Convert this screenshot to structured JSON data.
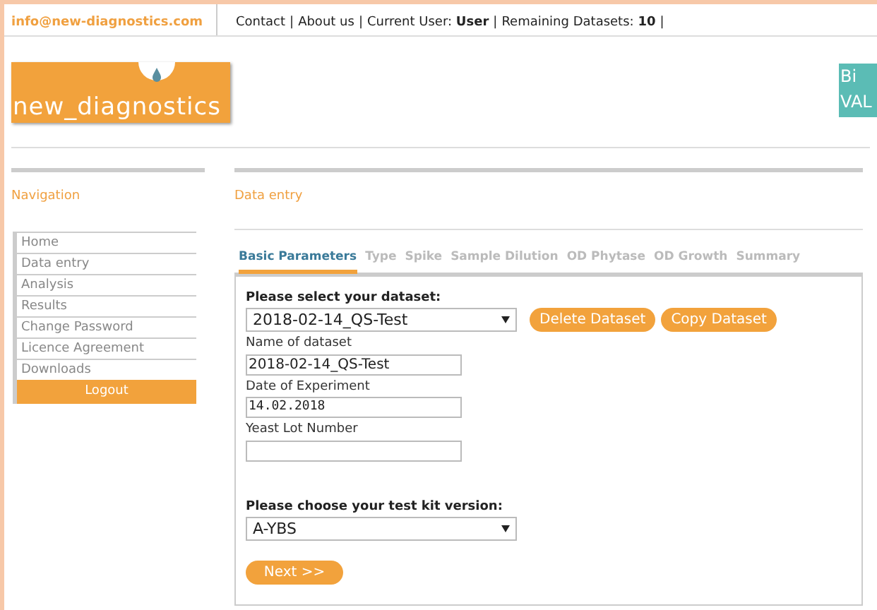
{
  "header": {
    "email": "info@new-diagnostics.com",
    "items": [
      {
        "kind": "link",
        "text": "Contact"
      },
      {
        "kind": "sep",
        "text": "|"
      },
      {
        "kind": "link",
        "text": "About us"
      },
      {
        "kind": "sep",
        "text": "|"
      },
      {
        "kind": "info",
        "label": "Current User:",
        "value": "User"
      },
      {
        "kind": "sep",
        "text": "|"
      },
      {
        "kind": "info",
        "label": "Remaining Datasets:",
        "value": "10"
      },
      {
        "kind": "sep",
        "text": "|"
      }
    ]
  },
  "logo": {
    "text": "new_diagnostics"
  },
  "partner_logo": {
    "lines": [
      "Bi",
      "VAL"
    ]
  },
  "navigation": {
    "title": "Navigation",
    "items": [
      "Home",
      "Data entry",
      "Analysis",
      "Results",
      "Change Password",
      "Licence Agreement",
      "Downloads"
    ],
    "logout": "Logout"
  },
  "main": {
    "title": "Data entry",
    "tabs": [
      {
        "label": "Basic Parameters",
        "selected": true
      },
      {
        "label": "Type",
        "selected": false
      },
      {
        "label": "Spike",
        "selected": false
      },
      {
        "label": "Sample Dilution",
        "selected": false
      },
      {
        "label": "OD Phytase",
        "selected": false
      },
      {
        "label": "OD Growth",
        "selected": false
      },
      {
        "label": "Summary",
        "selected": false
      }
    ],
    "dataset_select": {
      "label": "Please select your dataset:",
      "value": "2018-02-14_QS-Test"
    },
    "actions": [
      "Delete Dataset",
      "Copy Dataset"
    ],
    "fields": [
      {
        "label": "Name of dataset",
        "value": "2018-02-14_QS-Test",
        "kind": "text"
      },
      {
        "label": "Date of Experiment",
        "value": "14.02.2018",
        "kind": "date"
      },
      {
        "label": "Yeast Lot Number",
        "kind": "text"
      }
    ],
    "kit_select": {
      "label": "Please choose your test kit version:",
      "value": "A-YBS"
    },
    "next": "Next >>"
  }
}
